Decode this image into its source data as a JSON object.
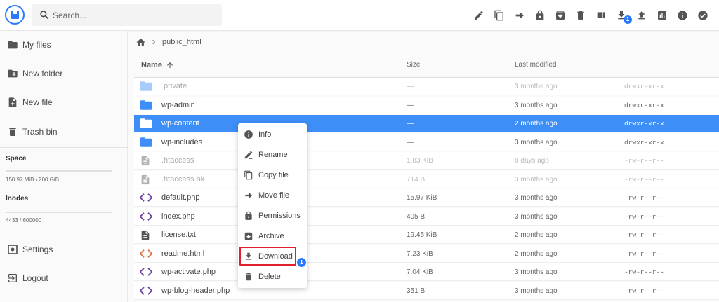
{
  "search": {
    "placeholder": "Search..."
  },
  "header": {
    "actions": [
      "edit-icon",
      "copy-icon",
      "move-icon",
      "lock-icon",
      "archive-icon",
      "delete-icon",
      "grid-view-icon",
      "download-icon",
      "upload-icon",
      "stats-icon",
      "info-icon",
      "check-circle-icon"
    ],
    "download_badge": "1"
  },
  "colors": {
    "accent": "#2979ff",
    "selected_row": "#3e8ef7",
    "folder": "#3e8ef7",
    "php_icon": "#6a3fa8",
    "html_icon": "#e06f3c",
    "highlight_border": "#e0202a"
  },
  "sidebar": {
    "items": [
      {
        "label": "My files",
        "icon": "folder-icon"
      },
      {
        "label": "New folder",
        "icon": "create-folder-icon"
      },
      {
        "label": "New file",
        "icon": "note-add-icon"
      },
      {
        "label": "Trash bin",
        "icon": "trash-icon"
      }
    ],
    "space": {
      "title": "Space",
      "value": "150.97 MiB / 200 GiB",
      "fraction": 0.001
    },
    "inodes": {
      "title": "Inodes",
      "value": "4433 / 600000",
      "fraction": 0.007
    },
    "bottom": [
      {
        "label": "Settings",
        "icon": "settings-icon"
      },
      {
        "label": "Logout",
        "icon": "logout-icon"
      }
    ]
  },
  "breadcrumb": {
    "path": "public_html"
  },
  "columns": {
    "name": "Name",
    "size": "Size",
    "modified": "Last modified"
  },
  "files": [
    {
      "name": ".private",
      "size": "—",
      "modified": "3 months ago",
      "perm": "drwxr-xr-x",
      "type": "folder",
      "dim": true,
      "selected": false
    },
    {
      "name": "wp-admin",
      "size": "—",
      "modified": "3 months ago",
      "perm": "drwxr-xr-x",
      "type": "folder",
      "dim": false,
      "selected": false
    },
    {
      "name": "wp-content",
      "size": "—",
      "modified": "2 months ago",
      "perm": "drwxr-xr-x",
      "type": "folder",
      "dim": false,
      "selected": true
    },
    {
      "name": "wp-includes",
      "size": "—",
      "modified": "3 months ago",
      "perm": "drwxr-xr-x",
      "type": "folder",
      "dim": false,
      "selected": false
    },
    {
      "name": ".htaccess",
      "size": "1.83 KiB",
      "modified": "8 days ago",
      "perm": "-rw-r--r--",
      "type": "file",
      "dim": true,
      "selected": false
    },
    {
      "name": ".htaccess.bk",
      "size": "714 B",
      "modified": "3 months ago",
      "perm": "-rw-r--r--",
      "type": "file",
      "dim": true,
      "selected": false
    },
    {
      "name": "default.php",
      "size": "15.97 KiB",
      "modified": "3 months ago",
      "perm": "-rw-r--r--",
      "type": "php",
      "dim": false,
      "selected": false
    },
    {
      "name": "index.php",
      "size": "405 B",
      "modified": "3 months ago",
      "perm": "-rw-r--r--",
      "type": "php",
      "dim": false,
      "selected": false
    },
    {
      "name": "license.txt",
      "size": "19.45 KiB",
      "modified": "2 months ago",
      "perm": "-rw-r--r--",
      "type": "text",
      "dim": false,
      "selected": false
    },
    {
      "name": "readme.html",
      "size": "7.23 KiB",
      "modified": "2 months ago",
      "perm": "-rw-r--r--",
      "type": "html",
      "dim": false,
      "selected": false
    },
    {
      "name": "wp-activate.php",
      "size": "7.04 KiB",
      "modified": "3 months ago",
      "perm": "-rw-r--r--",
      "type": "php",
      "dim": false,
      "selected": false
    },
    {
      "name": "wp-blog-header.php",
      "size": "351 B",
      "modified": "3 months ago",
      "perm": "-rw-r--r--",
      "type": "php",
      "dim": false,
      "selected": false
    }
  ],
  "context_menu": {
    "items": [
      {
        "label": "Info",
        "icon": "info-icon"
      },
      {
        "label": "Rename",
        "icon": "rename-icon"
      },
      {
        "label": "Copy file",
        "icon": "copy-icon"
      },
      {
        "label": "Move file",
        "icon": "move-icon"
      },
      {
        "label": "Permissions",
        "icon": "lock-icon"
      },
      {
        "label": "Archive",
        "icon": "archive-icon"
      },
      {
        "label": "Download",
        "icon": "download-icon"
      },
      {
        "label": "Delete",
        "icon": "delete-icon"
      }
    ],
    "download_badge": "1"
  }
}
